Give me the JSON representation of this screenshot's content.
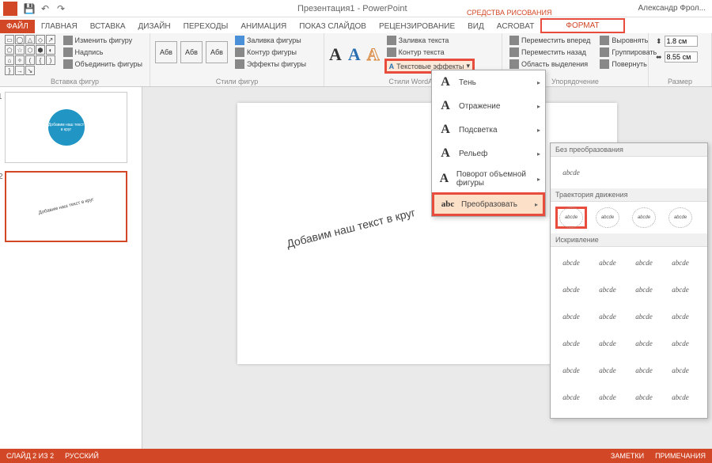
{
  "app": {
    "title": "Презентация1 - PowerPoint",
    "user": "Александр Фрол..."
  },
  "qat": {
    "save": "💾",
    "undo": "↶",
    "redo": "↷"
  },
  "tabs": {
    "file": "ФАЙЛ",
    "home": "ГЛАВНАЯ",
    "insert": "ВСТАВКА",
    "design": "ДИЗАЙН",
    "transitions": "ПЕРЕХОДЫ",
    "animations": "АНИМАЦИЯ",
    "slideshow": "ПОКАЗ СЛАЙДОВ",
    "review": "РЕЦЕНЗИРОВАНИЕ",
    "view": "ВИД",
    "acrobat": "ACROBAT",
    "context": "СРЕДСТВА РИСОВАНИЯ",
    "format": "ФОРМАТ"
  },
  "ribbon": {
    "shapes_group": "Вставка фигур",
    "edit_shape": "Изменить фигуру",
    "textbox": "Надпись",
    "merge": "Объединить фигуры",
    "styles_group": "Стили фигур",
    "abc": "Абв",
    "fill": "Заливка фигуры",
    "outline": "Контур фигуры",
    "effects": "Эффекты фигуры",
    "wordart_group": "Стили WordArt",
    "text_fill": "Заливка текста",
    "text_outline": "Контур текста",
    "text_effects": "Текстовые эффекты",
    "arrange_group": "Упорядочение",
    "bring_fwd": "Переместить вперед",
    "send_back": "Переместить назад",
    "selection": "Область выделения",
    "align": "Выровнять",
    "group": "Группировать",
    "rotate": "Повернуть",
    "size_group": "Размер",
    "height": "1.8 см",
    "width": "8.55 см"
  },
  "dropdown": {
    "shadow": "Тень",
    "reflection": "Отражение",
    "glow": "Подсветка",
    "bevel": "Рельеф",
    "rotation3d": "Поворот объемной фигуры",
    "transform": "Преобразовать"
  },
  "transform": {
    "none_header": "Без преобразования",
    "path_header": "Траектория движения",
    "warp_header": "Искривление",
    "sample": "abcde"
  },
  "slide": {
    "text": "Добавим наш текст в круг",
    "thumb1_text": "Добавим наш текст в круг"
  },
  "thumbs": {
    "n1": "1",
    "n2": "2"
  },
  "status": {
    "slide": "СЛАЙД 2 ИЗ 2",
    "lang": "РУССКИЙ",
    "notes": "ЗАМЕТКИ",
    "comments": "ПРИМЕЧАНИЯ"
  }
}
